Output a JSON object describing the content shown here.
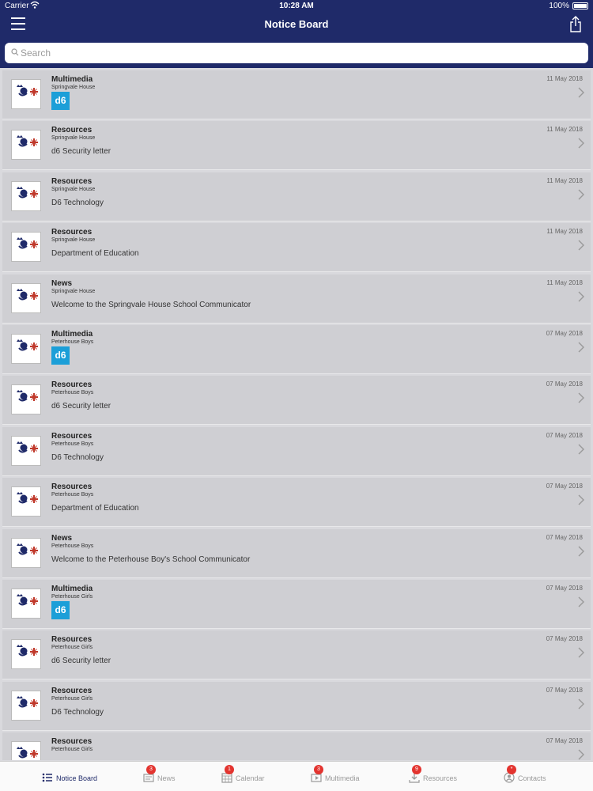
{
  "status_bar": {
    "carrier": "Carrier",
    "time": "10:28 AM",
    "battery": "100%"
  },
  "header": {
    "title": "Notice Board"
  },
  "search": {
    "placeholder": "Search"
  },
  "colors": {
    "brand": "#1f2a69",
    "d6": "#1c9fd8",
    "badge": "#e3342f"
  },
  "notices": [
    {
      "category": "Multimedia",
      "school": "Springvale House",
      "description": "",
      "badge": "d6",
      "date": "11 May 2018",
      "logo": [
        "SPRINGVALE",
        "HOUSE"
      ]
    },
    {
      "category": "Resources",
      "school": "Springvale House",
      "description": "d6 Security letter",
      "badge": "",
      "date": "11 May 2018",
      "logo": [
        "SPRINGVALE",
        "HOUSE"
      ]
    },
    {
      "category": "Resources",
      "school": "Springvale House",
      "description": "D6 Technology",
      "badge": "",
      "date": "11 May 2018",
      "logo": [
        "SPRINGVALE",
        "HOUSE"
      ]
    },
    {
      "category": "Resources",
      "school": "Springvale House",
      "description": "Department of Education",
      "badge": "",
      "date": "11 May 2018",
      "logo": [
        "SPRINGVALE",
        "HOUSE"
      ]
    },
    {
      "category": "News",
      "school": "Springvale House",
      "description": "Welcome to the Springvale House  School Communicator",
      "badge": "",
      "date": "11 May 2018",
      "logo": [
        "SPRINGVALE",
        "HOUSE"
      ]
    },
    {
      "category": "Multimedia",
      "school": "Peterhouse Boys",
      "description": "",
      "badge": "d6",
      "date": "07 May 2018",
      "logo": [
        "PETERHOUSE",
        "BOYS"
      ]
    },
    {
      "category": "Resources",
      "school": "Peterhouse Boys",
      "description": "d6 Security letter",
      "badge": "",
      "date": "07 May 2018",
      "logo": [
        "PETERHOUSE",
        "BOYS"
      ]
    },
    {
      "category": "Resources",
      "school": "Peterhouse Boys",
      "description": "D6 Technology",
      "badge": "",
      "date": "07 May 2018",
      "logo": [
        "PETERHOUSE",
        "BOYS"
      ]
    },
    {
      "category": "Resources",
      "school": "Peterhouse Boys",
      "description": "Department of Education",
      "badge": "",
      "date": "07 May 2018",
      "logo": [
        "PETERHOUSE",
        "BOYS"
      ]
    },
    {
      "category": "News",
      "school": "Peterhouse Boys",
      "description": "Welcome to the Peterhouse Boy's School Communicator",
      "badge": "",
      "date": "07 May 2018",
      "logo": [
        "PETERHOUSE",
        "BOYS"
      ]
    },
    {
      "category": "Multimedia",
      "school": "Peterhouse Girls",
      "description": "",
      "badge": "d6",
      "date": "07 May 2018",
      "logo": [
        "PETERHOUSE",
        "GIRLS"
      ]
    },
    {
      "category": "Resources",
      "school": "Peterhouse Girls",
      "description": "d6 Security letter",
      "badge": "",
      "date": "07 May 2018",
      "logo": [
        "PETERHOUSE",
        "GIRLS"
      ]
    },
    {
      "category": "Resources",
      "school": "Peterhouse Girls",
      "description": "D6 Technology",
      "badge": "",
      "date": "07 May 2018",
      "logo": [
        "PETERHOUSE",
        "GIRLS"
      ]
    },
    {
      "category": "Resources",
      "school": "Peterhouse Girls",
      "description": "",
      "badge": "",
      "date": "07 May 2018",
      "logo": [
        "PETERHOUSE",
        "GIRLS"
      ]
    }
  ],
  "tabs": [
    {
      "label": "Notice Board",
      "badge": "",
      "icon": "list-icon",
      "active": true
    },
    {
      "label": "News",
      "badge": "3",
      "icon": "news-icon",
      "active": false
    },
    {
      "label": "Calendar",
      "badge": "1",
      "icon": "calendar-icon",
      "active": false
    },
    {
      "label": "Multimedia",
      "badge": "3",
      "icon": "multimedia-icon",
      "active": false
    },
    {
      "label": "Resources",
      "badge": "9",
      "icon": "download-icon",
      "active": false
    },
    {
      "label": "Contacts",
      "badge": "*",
      "icon": "contacts-icon",
      "active": false
    }
  ]
}
